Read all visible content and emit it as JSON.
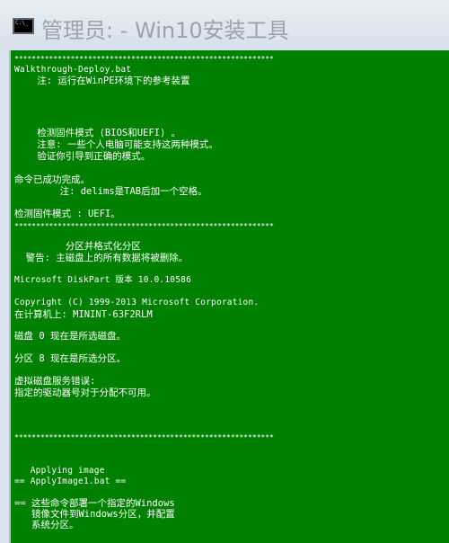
{
  "window": {
    "title": "管理员:  - Win10安装工具",
    "icon": "cmd-icon"
  },
  "console": {
    "background": "#008000",
    "foreground": "#ffffff",
    "lines": [
      "************************************************************",
      "Walkthrough-Deploy.bat",
      "    注: 运行在WinPE环境下的参考装置",
      "    检测固件模式 (BIOS和UEFI) 。",
      "    注意: 一些个人电脑可能支持这两种模式。",
      "    验证你引导到正确的模式。",
      "命令已成功完成。",
      "        注: delims是TAB后加一个空格。",
      "检测固件模式 : UEFI。",
      "************************************************************",
      "         分区并格式化分区",
      "  警告: 主磁盘上的所有数据将被删除。",
      "Microsoft DiskPart 版本 10.0.10586",
      "Copyright (C) 1999-2013 Microsoft Corporation.",
      "在计算机上: MININT-63F2RLM",
      "磁盘 0 现在是所选磁盘。",
      "分区 8 现在是所选分区。",
      "虚拟磁盘服务错误:",
      "指定的驱动器号对于分配不可用。",
      "************************************************************",
      "   Applying image",
      "== ApplyImage1.bat ==",
      "== 这些命令部署一个指定的Windows",
      "   镜像文件到Windows分区，并配置",
      "   系统分区。"
    ]
  }
}
